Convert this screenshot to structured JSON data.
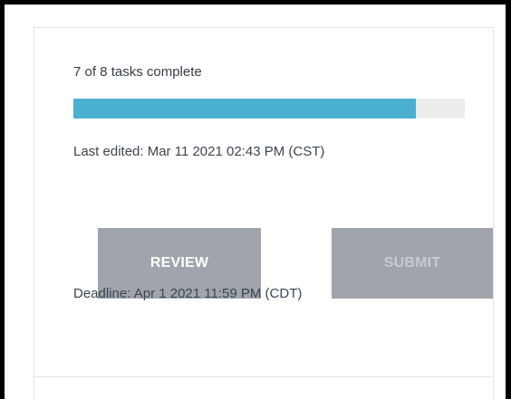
{
  "status": {
    "progress_text": "7 of 8 tasks complete",
    "completed_tasks": 7,
    "total_tasks": 8,
    "progress_fraction": 0.875,
    "last_edited": "Last edited: Mar 11 2021 02:43 PM (CST)",
    "deadline": "Deadline: Apr 1 2021 11:59 PM (CDT)"
  },
  "actions": {
    "review_label": "REVIEW",
    "submit_label": "SUBMIT",
    "submit_enabled": false
  },
  "colors": {
    "progress_fill": "#4ab0d0",
    "progress_track": "#ededed",
    "button_bg": "#9fa5aa",
    "button_text": "#ffffff",
    "button_disabled_text": "#c7cbcf"
  }
}
